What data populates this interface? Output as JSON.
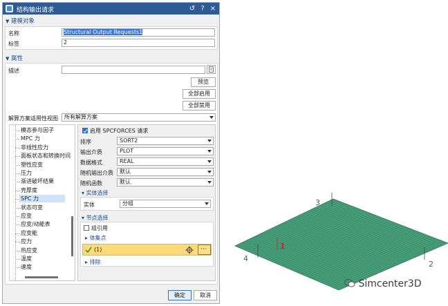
{
  "dialog": {
    "title": "结构输出请求",
    "window_buttons": [
      "↺",
      "?",
      "×"
    ]
  },
  "model_section": {
    "header": "建模对象",
    "name_label": "名称",
    "name_value": "Structural Output Requests1",
    "tag_label": "标签",
    "tag_value": "2"
  },
  "props_section": {
    "header": "属性",
    "desc_label": "描述",
    "desc_value": "",
    "preview_button": "预览",
    "enable_all_button": "全部启用",
    "disable_all_button": "全部禁用",
    "solution_view_label": "解算方案适用性视图",
    "solution_view_value": "所有解算方案"
  },
  "tree": {
    "items": [
      "模态参与因子",
      "MPC 力",
      "非线性应力",
      "面板状态和转换时间",
      "塑性应变",
      "压力",
      "渐进破坏结果",
      "壳厚度",
      "SPC 力",
      "状态可变",
      "应变",
      "应变/动能表",
      "应变能",
      "应力",
      "热应变",
      "温度",
      "速度"
    ],
    "selected_index": 8
  },
  "spc": {
    "enable_label": "启用 SPCFORCES 请求",
    "enabled": true,
    "rows": [
      {
        "label": "排序",
        "value": "SORT2"
      },
      {
        "label": "输出介质",
        "value": "PLOT"
      },
      {
        "label": "数据格式",
        "value": "REAL"
      },
      {
        "label": "随机输出介质",
        "value": "默认"
      },
      {
        "label": "随机函数",
        "value": "默认"
      }
    ],
    "entity_header": "实体选择",
    "entity_label": "实体",
    "entity_value": "分组",
    "node_header": "节点选择",
    "group_label": "组引用",
    "group_checked": false,
    "collection_label": "体集点",
    "selected_item": "(1)",
    "exclude_label": "排除"
  },
  "footer": {
    "ok_button": "确定",
    "cancel_button": "取消"
  },
  "viewport": {
    "labels": {
      "n1": "1",
      "n2": "2",
      "n3": "3",
      "n4": "4"
    },
    "watermark": "Simcenter3D",
    "mesh_color": "#4aa37e",
    "mesh_line_color": "#2f7a58"
  }
}
